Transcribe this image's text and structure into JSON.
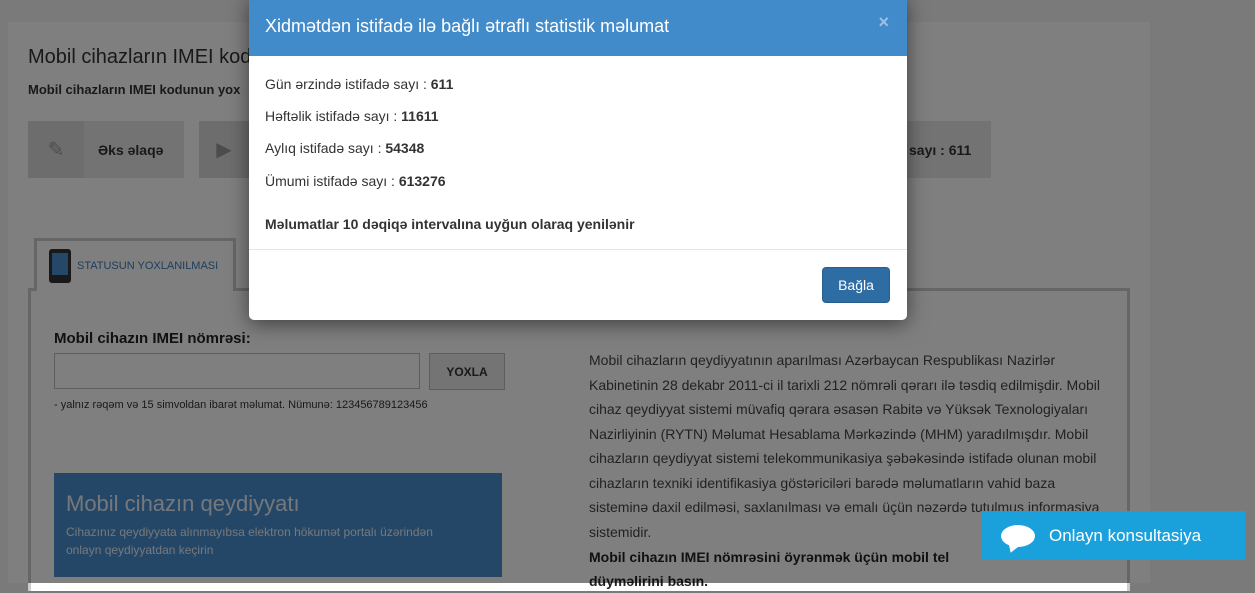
{
  "page": {
    "title": "Mobil cihazların IMEI kod",
    "subtitle": "Mobil cihazların IMEI kodunun yox",
    "tiles": [
      {
        "label": "Əks əlaqə",
        "icon": "edit-icon"
      },
      {
        "label": "",
        "icon": "document-play-icon"
      },
      {
        "label": "sayı : 611",
        "icon": ""
      }
    ],
    "tab_label": "STATUSUN YOXLANILMASI",
    "imei_label": "Mobil cihazın IMEI nömrəsi:",
    "check_button": "YOXLA",
    "hint": "- yalnız rəqəm və 15 simvoldan ibarət məlumat. Nümunə: 123456789123456",
    "banner": {
      "title": "Mobil cihazın qeydiyyatı",
      "subtitle": "Cihazınız qeydiyyata alınmayıbsa elektron hökumət portalı üzərindən onlayn qeydiyyatdan keçirin"
    },
    "info_text": "Mobil cihazların qeydiyyatının aparılması Azərbaycan Respublikası Nazirlər Kabinetinin 28 dekabr 2011-ci il tarixli 212 nömrəli qərarı ilə təsdiq edilmişdir. Mobil cihaz qeydiyyat sistemi müvafiq qərara əsasən Rabitə və Yüksək Texnologiyaları Nazirliyinin (RYTN) Məlumat Hesablama Mərkəzində (MHM) yaradılmışdır. Mobil cihazların qeydiyyat sistemi telekommunikasiya şəbəkəsində istifadə olunan mobil cihazların texniki identifikasiya göstəriciləri barədə məlumatların vahid baza sisteminə daxil edilməsi, saxlanılması və emalı üçün nəzərdə tutulmuş informasiya sistemidir.",
    "info_bold": "Mobil cihazın IMEI nömrəsini öyrənmək üçün mobil tel düyməlirini basın."
  },
  "modal": {
    "title": "Xidmətdən istifadə ilə bağlı ətraflı statistik məlumat",
    "close_icon": "×",
    "stats": [
      {
        "label": "Gün ərzində istifadə sayı : ",
        "value": "611"
      },
      {
        "label": "Həftəlik istifadə sayı : ",
        "value": "11611"
      },
      {
        "label": "Aylıq istifadə sayı : ",
        "value": "54348"
      },
      {
        "label": "Ümumi istifadə sayı : ",
        "value": "613276"
      }
    ],
    "note": "Məlumatlar 10 dəqiqə intervalına uyğun olaraq yenilənir",
    "close_button": "Bağla"
  },
  "chat": {
    "label": "Onlayn konsultasiya",
    "icon": "chat-bubble-icon"
  },
  "colors": {
    "modal_header": "#428bca",
    "close_button": "#2e6da4",
    "chat_button": "#1aa1db"
  }
}
